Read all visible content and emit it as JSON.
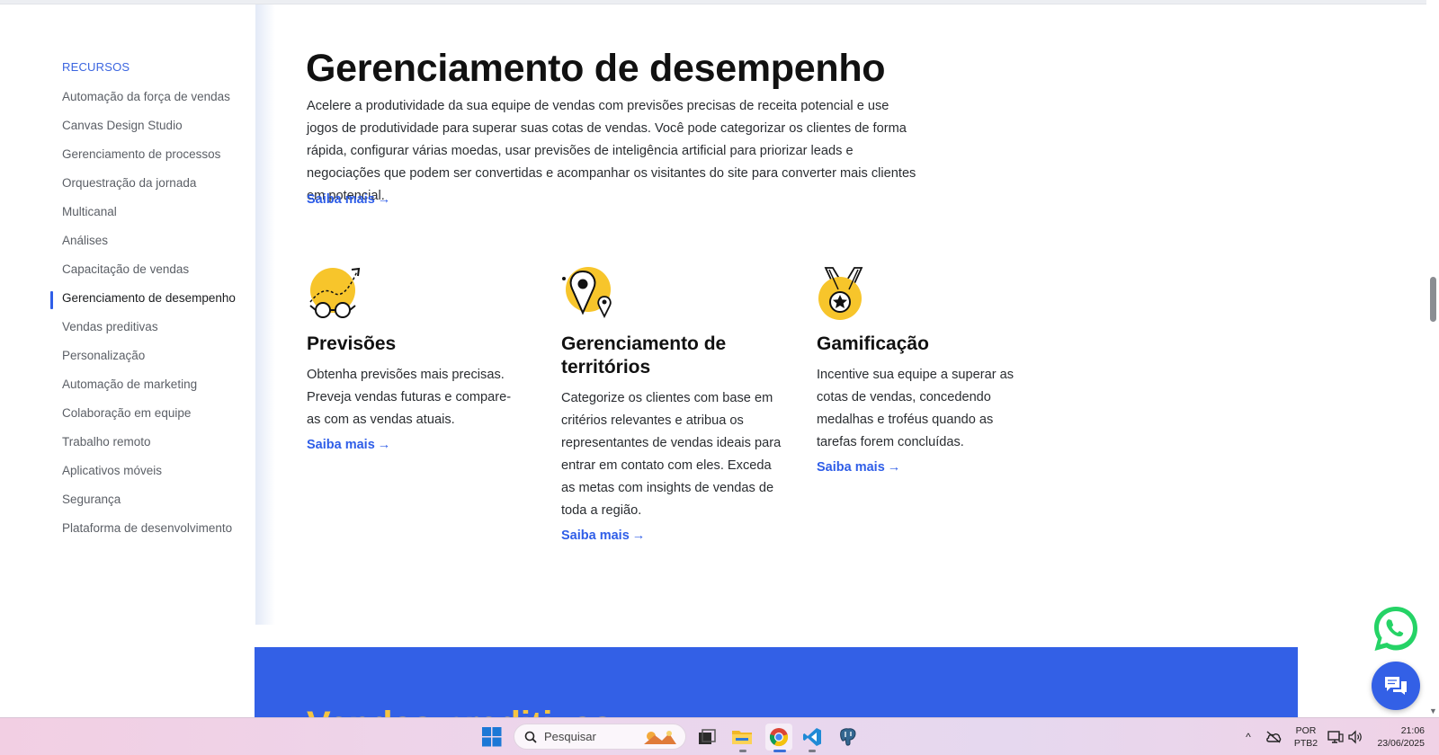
{
  "sidebar": {
    "heading": "RECURSOS",
    "items": [
      {
        "label": "Automação da força de vendas"
      },
      {
        "label": "Canvas Design Studio"
      },
      {
        "label": "Gerenciamento de processos"
      },
      {
        "label": "Orquestração da jornada"
      },
      {
        "label": "Multicanal"
      },
      {
        "label": "Análises"
      },
      {
        "label": "Capacitação de vendas"
      },
      {
        "label": "Gerenciamento de desempenho",
        "active": true
      },
      {
        "label": "Vendas preditivas"
      },
      {
        "label": "Personalização"
      },
      {
        "label": "Automação de marketing"
      },
      {
        "label": "Colaboração em equipe"
      },
      {
        "label": "Trabalho remoto"
      },
      {
        "label": "Aplicativos móveis"
      },
      {
        "label": "Segurança"
      },
      {
        "label": "Plataforma de desenvolvimento"
      }
    ]
  },
  "main": {
    "title": "Gerenciamento de desempenho",
    "description": "Acelere a produtividade da sua equipe de vendas com previsões precisas de receita potencial e use jogos de produtividade para superar suas cotas de vendas. Você pode categorizar os clientes de forma rápida, configurar várias moedas, usar previsões de inteligência artificial para priorizar leads e negociações que podem ser convertidas e acompanhar os visitantes do site para converter mais clientes em potencial.",
    "link": "Saiba mais",
    "arrow": "→"
  },
  "cards": [
    {
      "icon": "forecast-icon",
      "title": "Previsões",
      "text": "Obtenha previsões mais precisas. Preveja vendas futuras e compare-as com as vendas atuais.",
      "link": "Saiba mais"
    },
    {
      "icon": "territory-pin-icon",
      "title": "Gerenciamento de territórios",
      "text": "Categorize os clientes com base em critérios relevantes e atribua os representantes de vendas ideais para entrar em contato com eles. Exceda as metas com insights de vendas de toda a região.",
      "link": "Saiba mais"
    },
    {
      "icon": "medal-icon",
      "title": "Gamificação",
      "text": "Incentive sua equipe a superar as cotas de vendas, concedendo medalhas e troféus quando as tarefas forem concluídas.",
      "link": "Saiba mais"
    }
  ],
  "banner": {
    "title": "Vendas preditivas"
  },
  "taskbar": {
    "search_placeholder": "Pesquisar",
    "lang_top": "POR",
    "lang_bottom": "PTB2",
    "time": "21:06",
    "date": "23/06/2025"
  },
  "colors": {
    "accent": "#2f5ee8",
    "banner": "#3360e6",
    "icon_yellow": "#f7c52b",
    "whatsapp": "#25d366"
  }
}
